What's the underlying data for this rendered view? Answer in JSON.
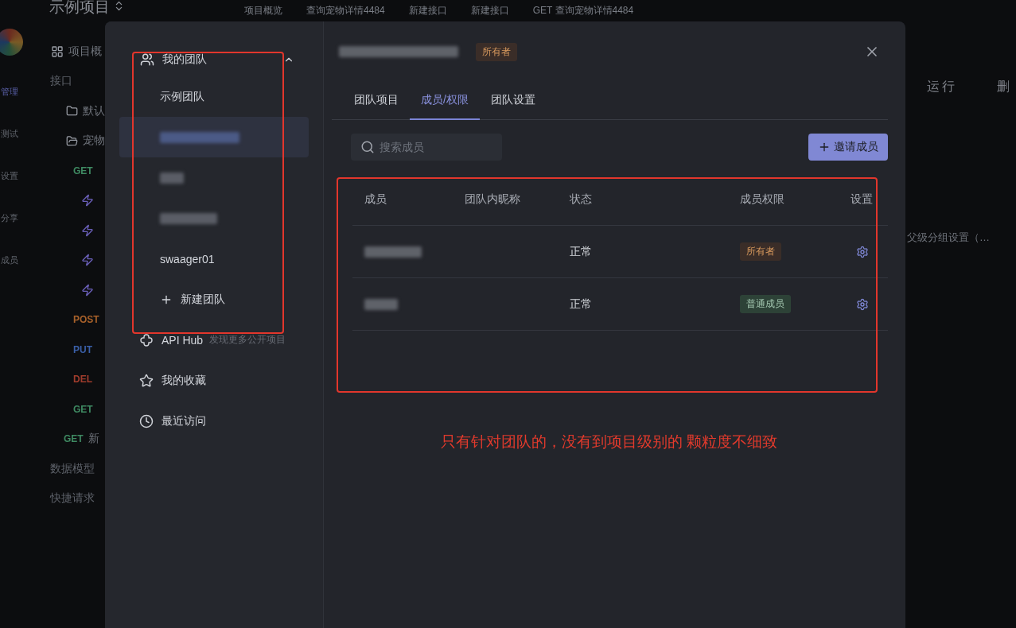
{
  "app": {
    "project_title": "示例项目",
    "top_tabs": [
      {
        "label": "项目概览"
      },
      {
        "label": "查询宠物详情4484"
      },
      {
        "label": "新建接口"
      },
      {
        "label": "新建接口"
      },
      {
        "method": "GET",
        "label": "查询宠物详情4484"
      }
    ],
    "rail": [
      {
        "label": "管理",
        "selected": true
      },
      {
        "label": "测试",
        "selected": false
      },
      {
        "label": "设置",
        "selected": false
      },
      {
        "label": "分享",
        "selected": false
      },
      {
        "label": "成员",
        "selected": false
      }
    ],
    "sidebar": [
      {
        "kind": "overview",
        "label": "项目概"
      },
      {
        "kind": "section",
        "label": "接口"
      },
      {
        "kind": "folder",
        "label": "默认"
      },
      {
        "kind": "folder-open",
        "label": "宠物"
      },
      {
        "kind": "method",
        "label": "GET",
        "color": "#3f8a62"
      },
      {
        "kind": "endpoint"
      },
      {
        "kind": "endpoint"
      },
      {
        "kind": "endpoint"
      },
      {
        "kind": "endpoint"
      },
      {
        "kind": "method",
        "label": "POST",
        "color": "#a8612a"
      },
      {
        "kind": "method",
        "label": "PUT",
        "color": "#3a5fa8"
      },
      {
        "kind": "method",
        "label": "DEL",
        "color": "#a03c2c"
      },
      {
        "kind": "method",
        "label": "GET",
        "color": "#3f8a62"
      },
      {
        "kind": "request",
        "label": "GET",
        "name": "新",
        "color": "#3f8a62"
      },
      {
        "kind": "section",
        "label": "数据模型"
      },
      {
        "kind": "section",
        "label": "快捷请求"
      }
    ],
    "toolbar": [
      "运行",
      "删"
    ],
    "hint": "父级分组设置（…"
  },
  "modal": {
    "nav": {
      "my_teams": {
        "label": "我的团队",
        "expanded": true,
        "teams": [
          {
            "kind": "text",
            "name": "示例团队",
            "selected": false
          },
          {
            "kind": "redacted",
            "selected": true
          },
          {
            "kind": "redacted",
            "selected": false
          },
          {
            "kind": "redacted",
            "selected": false
          },
          {
            "kind": "text",
            "name": "swaager01",
            "selected": false
          }
        ],
        "new_team": "新建团队"
      },
      "links": [
        {
          "kind": "hub",
          "label": "API Hub",
          "hint": "发现更多公开项目"
        },
        {
          "kind": "star",
          "label": "我的收藏"
        },
        {
          "kind": "clock",
          "label": "最近访问"
        }
      ]
    },
    "team": {
      "name": {
        "kind": "redacted"
      },
      "role_badge": "所有者"
    },
    "tabs": [
      {
        "label": "团队项目",
        "selected": false
      },
      {
        "label": "成员/权限",
        "selected": true
      },
      {
        "label": "团队设置",
        "selected": false
      }
    ],
    "search": {
      "placeholder": "搜索成员"
    },
    "invite_button": "邀请成员",
    "table": {
      "columns": [
        "成员",
        "团队内昵称",
        "状态",
        "成员权限",
        "设置"
      ],
      "rows": [
        {
          "member": {
            "kind": "redacted"
          },
          "status": "正常",
          "role": {
            "kind": "owner",
            "label": "所有者"
          }
        },
        {
          "member": {
            "kind": "redacted"
          },
          "status": "正常",
          "role": {
            "kind": "member",
            "label": "普通成员"
          }
        }
      ]
    }
  },
  "annotation": "只有针对团队的，没有到项目级别的 颗粒度不细致"
}
